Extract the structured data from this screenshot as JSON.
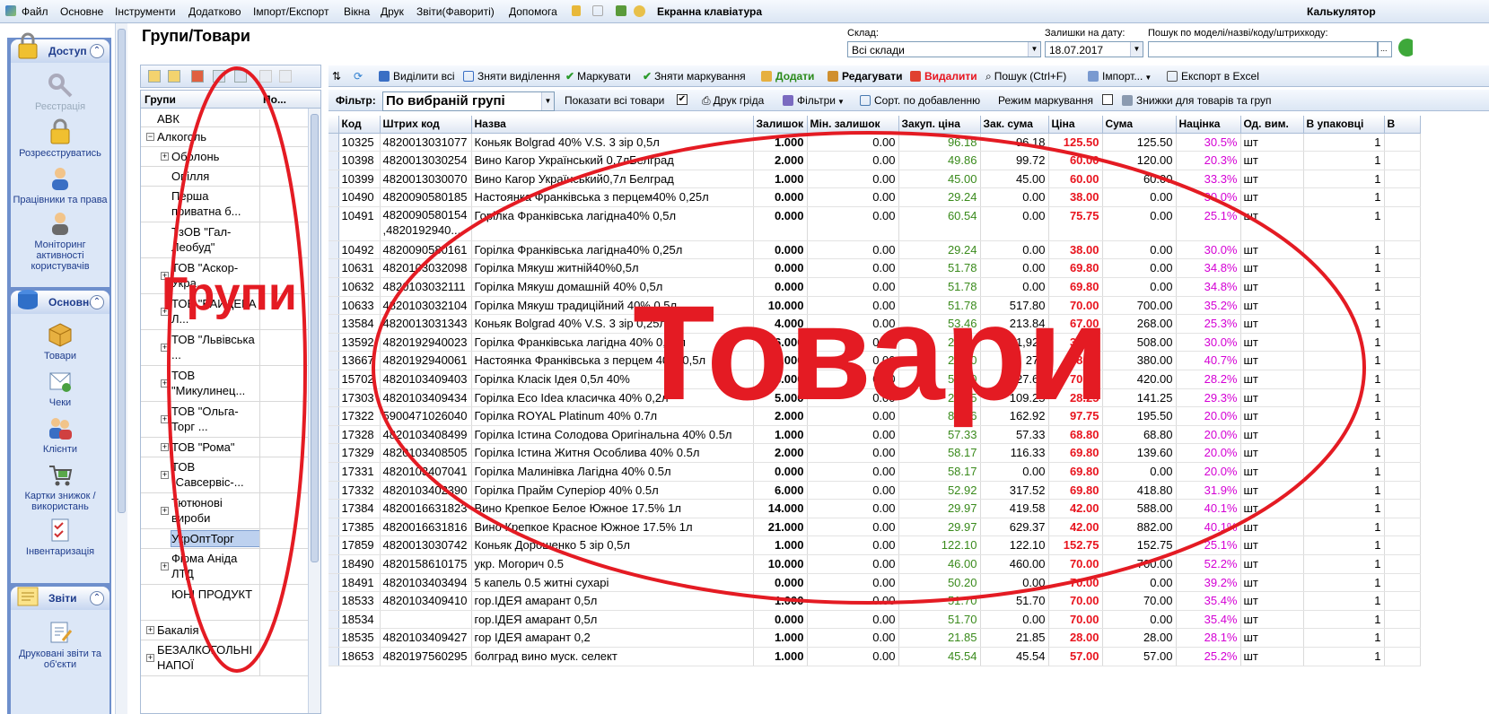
{
  "menu": {
    "items": [
      "Файл",
      "Основне",
      "Інструменти",
      "Додатково",
      "Імпорт/Експорт",
      "Вікна",
      "Друк",
      "Звіти(Фавориті)",
      "Допомога"
    ],
    "virtual_keyboard": "Екранна клавіатура",
    "calculator": "Калькулятор"
  },
  "sidebar": {
    "access": {
      "title": "Доступ",
      "items": [
        "Реєстрація",
        "Розреєструватись",
        "Працівники та права",
        "Моніторинг активності користувачів"
      ]
    },
    "main": {
      "title": "Основне",
      "items": [
        "Товари",
        "Чеки",
        "Клієнти",
        "Картки знижок / використань",
        "Інвентаризація"
      ]
    },
    "reports": {
      "title": "Звіти",
      "items": [
        "Друковані звіти та об'єкти"
      ]
    }
  },
  "page": {
    "title": "Групи/Товари"
  },
  "filters": {
    "warehouse_label": "Склад:",
    "warehouse_value": "Всі склади",
    "date_label": "Залишки на дату:",
    "date_value": "18.07.2017",
    "search_label": "Пошук по моделі/назві/коду/штрихкоду:",
    "search_value": ""
  },
  "groups": {
    "col_groups": "Групи",
    "col_po": "По...",
    "rows": [
      {
        "label": "АВК",
        "level": 0,
        "exp": ""
      },
      {
        "label": "Алкоголь",
        "level": 0,
        "exp": "−"
      },
      {
        "label": "Оболонь",
        "level": 1,
        "exp": "+"
      },
      {
        "label": "Опілля",
        "level": 1,
        "exp": ""
      },
      {
        "label": "Перша приватна б...",
        "level": 1,
        "exp": ""
      },
      {
        "label": "ТзОВ \"Гал-Леобуд\"",
        "level": 1,
        "exp": ""
      },
      {
        "label": "ТОВ \"Аскор-Укра...",
        "level": 1,
        "exp": "+"
      },
      {
        "label": "ТОВ \"БАЙДЕРА Л...",
        "level": 1,
        "exp": "+"
      },
      {
        "label": "ТОВ \"Львівська ...",
        "level": 1,
        "exp": "+"
      },
      {
        "label": "ТОВ \"Микулинец...",
        "level": 1,
        "exp": "+"
      },
      {
        "label": "ТОВ \"Ольга-Торг ...",
        "level": 1,
        "exp": "+"
      },
      {
        "label": "ТОВ \"Рома\"",
        "level": 1,
        "exp": "+"
      },
      {
        "label": "ТОВ \"Савсервіс-...",
        "level": 1,
        "exp": "+"
      },
      {
        "label": "Тютюнові вироби",
        "level": 1,
        "exp": "+"
      },
      {
        "label": "УкрОптТорг",
        "level": 1,
        "exp": "",
        "selected": true
      },
      {
        "label": "Фірма Аніда ЛТД",
        "level": 1,
        "exp": "+"
      },
      {
        "label": "ЮНІ ПРОДУКТ",
        "level": 1,
        "exp": ""
      },
      {
        "label": "Бакалія",
        "level": 0,
        "exp": "+"
      },
      {
        "label": "БЕЗАЛКОГОЛЬНІ НАПОЇ",
        "level": 0,
        "exp": "+"
      }
    ]
  },
  "toolbar1": {
    "select_all": "Виділити всі",
    "deselect": "Зняти виділення",
    "mark": "Маркувати",
    "unmark": "Зняти маркування",
    "add": "Додати",
    "edit": "Редагувати",
    "delete": "Видалити",
    "search": "Пошук (Ctrl+F)",
    "import": "Імпорт...",
    "export": "Експорт в Excel"
  },
  "toolbar2": {
    "filter_label": "Фільтр:",
    "filter_value": "По вибраній групі",
    "show_all": "Показати всі товари",
    "print_grid": "Друк гріда",
    "filters": "Фільтри",
    "sort": "Сорт. по добавленню",
    "marking_mode": "Режим маркування",
    "discounts": "Знижки для товарів та груп"
  },
  "grid": {
    "columns": [
      "Код",
      "Штрих код",
      "Назва",
      "Залишок",
      "Мін. залишок",
      "Закуп. ціна",
      "Зак. сума",
      "Ціна",
      "Сума",
      "Націнка",
      "Од. вим.",
      "В упаковці",
      "В"
    ],
    "rows": [
      [
        "10325",
        "4820013031077",
        "Коньяк Bolgrad 40% V.S. 3 зір 0,5л",
        "1.000",
        "0.00",
        "96.18",
        "96.18",
        "125.50",
        "125.50",
        "30.5%",
        "шт",
        "1"
      ],
      [
        "10398",
        "4820013030254",
        "Вино Кагор Український 0,7лБелград",
        "2.000",
        "0.00",
        "49.86",
        "99.72",
        "60.00",
        "120.00",
        "20.3%",
        "шт",
        "1"
      ],
      [
        "10399",
        "4820013030070",
        "Вино Кагор Український0,7л Белград",
        "1.000",
        "0.00",
        "45.00",
        "45.00",
        "60.00",
        "60.00",
        "33.3%",
        "шт",
        "1"
      ],
      [
        "10490",
        "4820090580185",
        "Настоянка Франківська з перцем40% 0,25л",
        "0.000",
        "0.00",
        "29.24",
        "0.00",
        "38.00",
        "0.00",
        "30.0%",
        "шт",
        "1"
      ],
      [
        "10491",
        "4820090580154 ,4820192940...",
        "Горілка Франківська лагідна40% 0,5л",
        "0.000",
        "0.00",
        "60.54",
        "0.00",
        "75.75",
        "0.00",
        "25.1%",
        "шт",
        "1"
      ],
      [
        "10492",
        "4820090580161",
        "Горілка Франківська лагідна40% 0,25л",
        "0.000",
        "0.00",
        "29.24",
        "0.00",
        "38.00",
        "0.00",
        "30.0%",
        "шт",
        "1"
      ],
      [
        "10631",
        "4820103032098",
        "Горілка Мякуш житній40%0,5л",
        "0.000",
        "0.00",
        "51.78",
        "0.00",
        "69.80",
        "0.00",
        "34.8%",
        "шт",
        "1"
      ],
      [
        "10632",
        "4820103032111",
        "Горілка Мякуш домашній 40% 0,5л",
        "0.000",
        "0.00",
        "51.78",
        "0.00",
        "69.80",
        "0.00",
        "34.8%",
        "шт",
        "1"
      ],
      [
        "10633",
        "4820103032104",
        "Горілка Мякуш традиційний 40% 0,5л",
        "10.000",
        "0.00",
        "51.78",
        "517.80",
        "70.00",
        "700.00",
        "35.2%",
        "шт",
        "1"
      ],
      [
        "13584",
        "4820013031343",
        "Коньяк Bolgrad 40% V.S. 3 зір 0,25л",
        "4.000",
        "0.00",
        "53.46",
        "213.84",
        "67.00",
        "268.00",
        "25.3%",
        "шт",
        "1"
      ],
      [
        "13592",
        "4820192940023",
        "Горілка Франківська лагідна 40% 0,25л",
        "6.000",
        "0.00",
        "29.24",
        "1,929",
        "38.00",
        "508.00",
        "30.0%",
        "шт",
        "1"
      ],
      [
        "13667",
        "4820192940061",
        "Настоянка Франківська з перцем 40% 0,5л",
        "10.000",
        "0.00",
        "27.00",
        "270",
        "38.00",
        "380.00",
        "40.7%",
        "шт",
        "1"
      ],
      [
        "15702",
        "4820103409403",
        "Горілка Класік Ідея 0,5л 40%",
        "6.000",
        "0.00",
        "54.60",
        "327.60",
        "70.00",
        "420.00",
        "28.2%",
        "шт",
        "1"
      ],
      [
        "17303",
        "4820103409434",
        "Горілка Eco Idea класичка 40% 0,2л",
        "5.000",
        "0.00",
        "21.85",
        "109.25",
        "28.25",
        "141.25",
        "29.3%",
        "шт",
        "1"
      ],
      [
        "17322",
        "5900471026040",
        "Горілка ROYAL Platinum 40% 0.7л",
        "2.000",
        "0.00",
        "81.46",
        "162.92",
        "97.75",
        "195.50",
        "20.0%",
        "шт",
        "1"
      ],
      [
        "17328",
        "4820103408499",
        "Горілка Істина Солодова Оригінальна 40% 0.5л",
        "1.000",
        "0.00",
        "57.33",
        "57.33",
        "68.80",
        "68.80",
        "20.0%",
        "шт",
        "1"
      ],
      [
        "17329",
        "4820103408505",
        "Горілка Істина Житня Особлива 40% 0.5л",
        "2.000",
        "0.00",
        "58.17",
        "116.33",
        "69.80",
        "139.60",
        "20.0%",
        "шт",
        "1"
      ],
      [
        "17331",
        "4820103407041",
        "Горілка Малинівка Лагідна 40% 0.5л",
        "0.000",
        "0.00",
        "58.17",
        "0.00",
        "69.80",
        "0.00",
        "20.0%",
        "шт",
        "1"
      ],
      [
        "17332",
        "4820103402390",
        "Горілка Прайм Суперіор 40% 0.5л",
        "6.000",
        "0.00",
        "52.92",
        "317.52",
        "69.80",
        "418.80",
        "31.9%",
        "шт",
        "1"
      ],
      [
        "17384",
        "4820016631823",
        "Вино Крепкое Белое Южное 17.5% 1л",
        "14.000",
        "0.00",
        "29.97",
        "419.58",
        "42.00",
        "588.00",
        "40.1%",
        "шт",
        "1"
      ],
      [
        "17385",
        "4820016631816",
        "Вино Крепкое Красное Южное 17.5% 1л",
        "21.000",
        "0.00",
        "29.97",
        "629.37",
        "42.00",
        "882.00",
        "40.1%",
        "шт",
        "1"
      ],
      [
        "17859",
        "4820013030742",
        "Коньяк Дорошенко 5 зір 0,5л",
        "1.000",
        "0.00",
        "122.10",
        "122.10",
        "152.75",
        "152.75",
        "25.1%",
        "шт",
        "1"
      ],
      [
        "18490",
        "4820158610175",
        "укр. Могорич 0.5",
        "10.000",
        "0.00",
        "46.00",
        "460.00",
        "70.00",
        "700.00",
        "52.2%",
        "шт",
        "1"
      ],
      [
        "18491",
        "4820103403494",
        "5 капель 0.5 житні сухарі",
        "0.000",
        "0.00",
        "50.20",
        "0.00",
        "70.00",
        "0.00",
        "39.2%",
        "шт",
        "1"
      ],
      [
        "18533",
        "4820103409410",
        "гор.ІДЕЯ амарант 0,5л",
        "1.000",
        "0.00",
        "51.70",
        "51.70",
        "70.00",
        "70.00",
        "35.4%",
        "шт",
        "1"
      ],
      [
        "18534",
        "",
        "гор.ІДЕЯ амарант 0,5л",
        "0.000",
        "0.00",
        "51.70",
        "0.00",
        "70.00",
        "0.00",
        "35.4%",
        "шт",
        "1"
      ],
      [
        "18535",
        "4820103409427",
        "гор ІДЕЯ амарант 0,2",
        "1.000",
        "0.00",
        "21.85",
        "21.85",
        "28.00",
        "28.00",
        "28.1%",
        "шт",
        "1"
      ],
      [
        "18653",
        "4820197560295",
        "болград вино муск. селект",
        "1.000",
        "0.00",
        "45.54",
        "45.54",
        "57.00",
        "57.00",
        "25.2%",
        "шт",
        "1"
      ]
    ]
  },
  "annotations": {
    "groups": "Групи",
    "goods": "Товари",
    "color": "#e41b23"
  },
  "colors": {
    "price": "#e8141e",
    "purchase": "#3a8a1c",
    "markup": "#d400d4",
    "sidebar": "#6e8fcc"
  }
}
